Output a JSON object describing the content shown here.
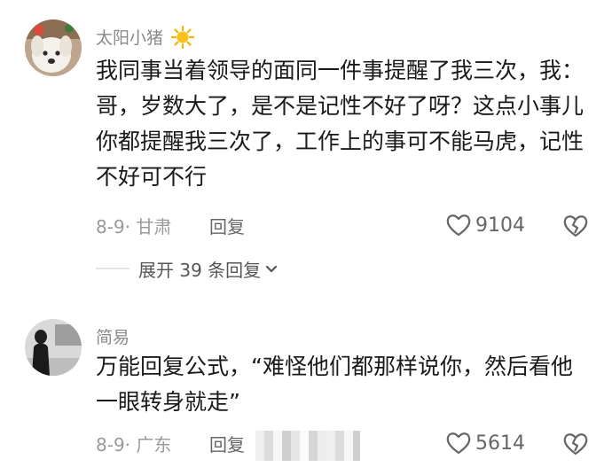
{
  "comments": [
    {
      "username": "太阳小猪",
      "username_icon": "sun-icon",
      "text": "我同事当着领导的面同一件事提醒了我三次，我：哥，岁数大了，是不是记性不好了呀？这点小事儿你都提醒我三次了，工作上的事可不能马虎，记性不好可不行",
      "date": "8-9",
      "location": "甘肃",
      "meta": "8-9· 甘肃",
      "reply_label": "回复",
      "likes": "9104",
      "expand_replies": "展开 39 条回复"
    },
    {
      "username": "简易",
      "text": "万能回复公式，“难怪他们都那样说你，然后看他一眼转身就走”",
      "date": "8-9",
      "location": "广东",
      "meta": "8-9· 广东",
      "reply_label": "回复",
      "likes": "5614"
    }
  ],
  "colors": {
    "username": "#8a8a8a",
    "text": "#1a1a1a",
    "meta": "#9a9a9a",
    "sun": "#f5b400"
  }
}
